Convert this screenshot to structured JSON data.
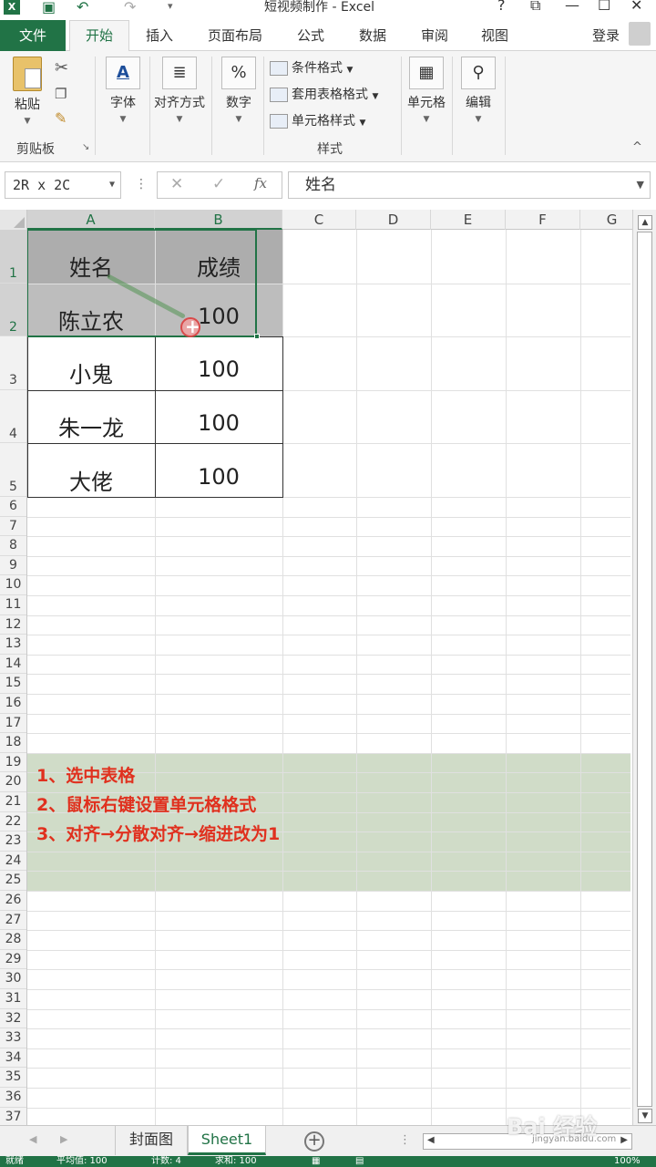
{
  "window": {
    "title": "短视频制作 - Excel",
    "app_letter": "X",
    "help": "?",
    "restore": "⧉",
    "minimize": "—",
    "maximize": "☐",
    "close": "✕"
  },
  "ribbon_tabs": {
    "file": "文件",
    "home": "开始",
    "insert": "插入",
    "page_layout": "页面布局",
    "formulas": "公式",
    "data": "数据",
    "review": "审阅",
    "view": "视图",
    "login": "登录"
  },
  "ribbon": {
    "paste": "粘贴",
    "clipboard": "剪贴板",
    "font": "字体",
    "alignment": "对齐方式",
    "number": "数字",
    "conditional_format": "条件格式",
    "table_format": "套用表格格式",
    "cell_style": "单元格样式",
    "styles": "样式",
    "cells": "单元格",
    "editing": "编辑",
    "font_icon": "A",
    "number_icon": "%",
    "collapse": "^"
  },
  "formula_bar": {
    "name_box": "2R x 2C",
    "cancel": "✕",
    "enter": "✓",
    "fx": "fx",
    "content": "姓名"
  },
  "columns": [
    "A",
    "B",
    "C",
    "D",
    "E",
    "F",
    "G"
  ],
  "rows": [
    "1",
    "2",
    "3",
    "4",
    "5",
    "6",
    "7",
    "8",
    "9",
    "10",
    "11",
    "12",
    "13",
    "14",
    "15",
    "16",
    "17",
    "18",
    "19",
    "20",
    "21",
    "22",
    "23",
    "24",
    "25",
    "26",
    "27",
    "28",
    "29",
    "30",
    "31",
    "32",
    "33",
    "34",
    "35",
    "36",
    "37"
  ],
  "table": {
    "header": [
      "姓名",
      "成绩"
    ],
    "rows": [
      [
        "陈立农",
        "100"
      ],
      [
        "小鬼",
        "100"
      ],
      [
        "朱一龙",
        "100"
      ],
      [
        "大佬",
        "100"
      ]
    ]
  },
  "instructions": [
    "1、选中表格",
    "2、鼠标右键设置单元格格式",
    "3、对齐→分散对齐→缩进改为1"
  ],
  "sheets": [
    "封面图",
    "Sheet1"
  ],
  "watermark": {
    "main": "Bai 经验",
    "sub": "jingyan.baidu.com"
  },
  "status": {
    "ready": "就绪",
    "average": "平均值: 100",
    "count": "计数: 4",
    "sum": "求和: 100",
    "zoom": "100%"
  },
  "colors": {
    "excel_green": "#217346",
    "note_bg": "#d0dcc8",
    "note_text": "#e0301e"
  }
}
